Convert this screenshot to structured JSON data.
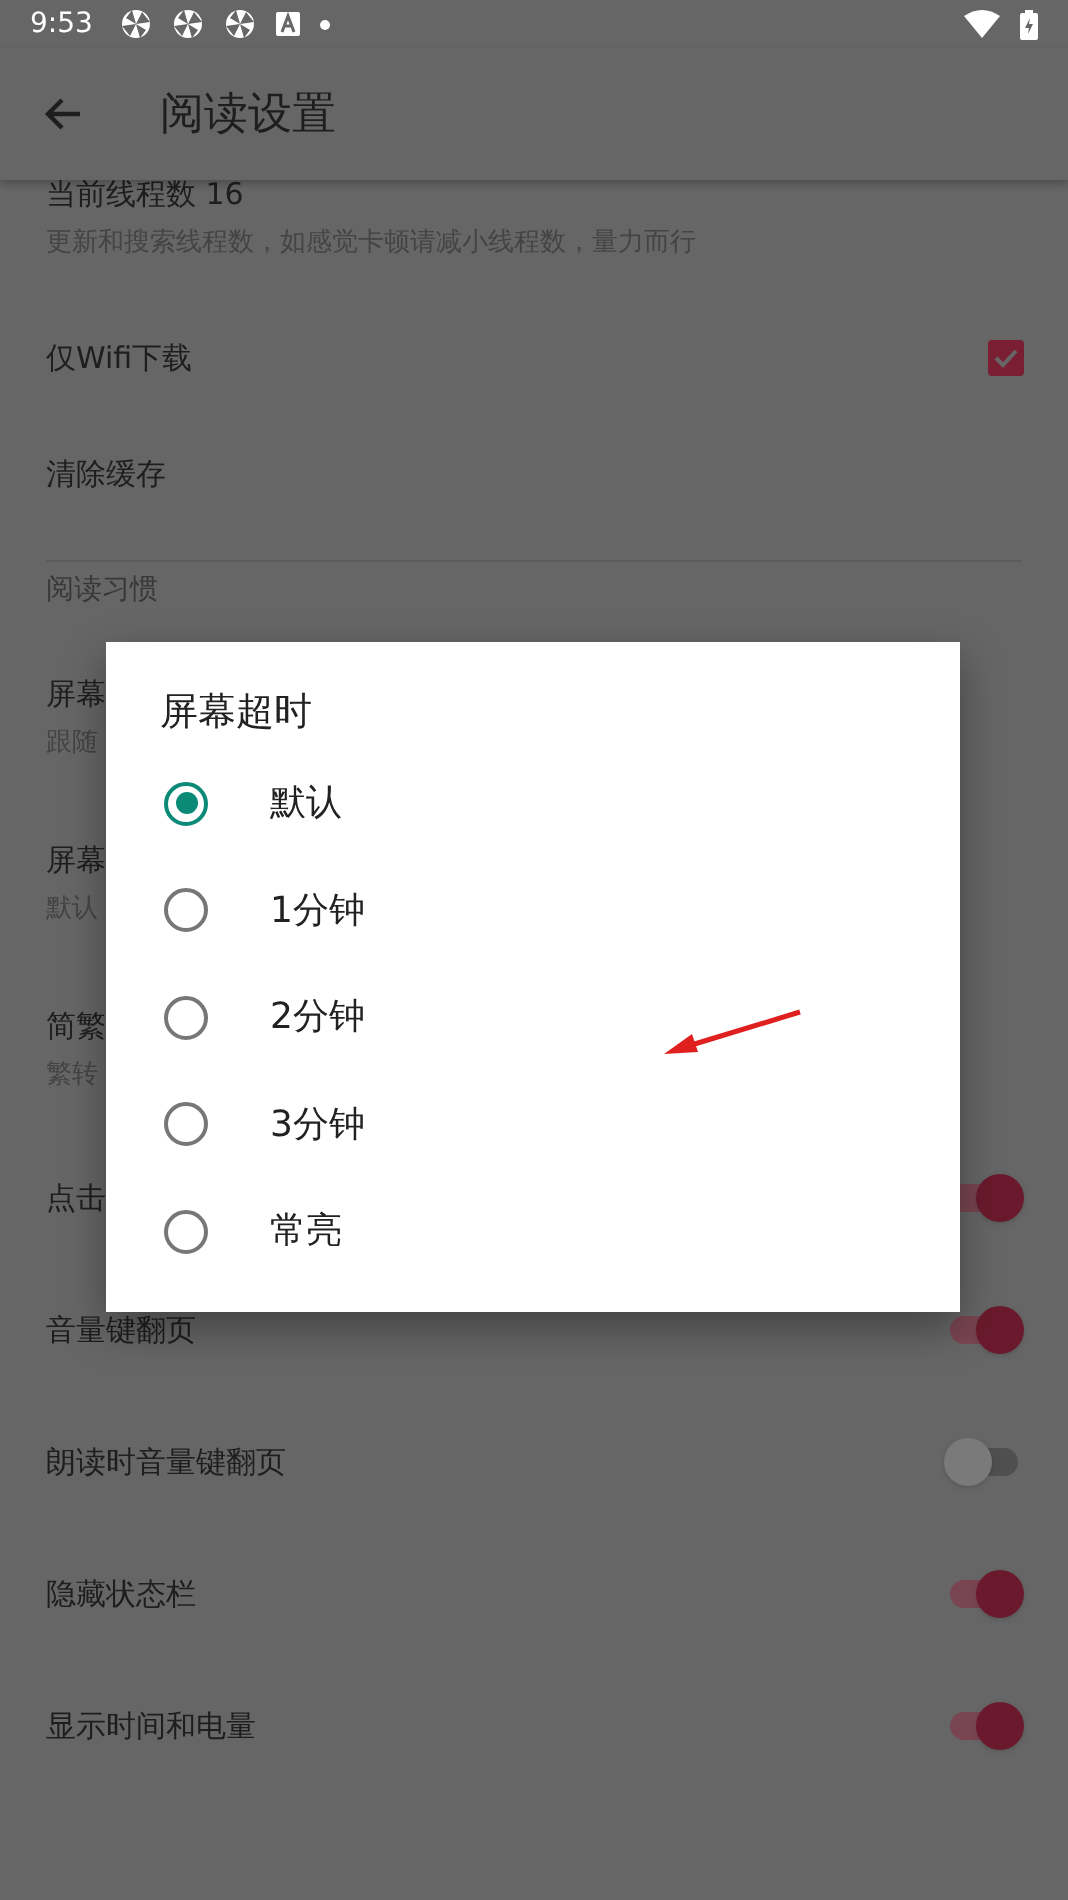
{
  "status_bar": {
    "time": "9:53"
  },
  "toolbar": {
    "title": "阅读设置"
  },
  "settings": [
    {
      "kind": "text",
      "title": "当前线程数 16",
      "summary": "更新和搜索线程数，如感觉卡顿请减小线程数，量力而行"
    },
    {
      "kind": "checkbox",
      "title": "仅Wifi下载",
      "checked": true
    },
    {
      "kind": "action",
      "title": "清除缓存"
    },
    {
      "kind": "divider"
    },
    {
      "kind": "category",
      "title": "阅读习惯"
    },
    {
      "kind": "text",
      "title": "屏幕",
      "summary": "跟随"
    },
    {
      "kind": "text",
      "title": "屏幕",
      "summary": "默认"
    },
    {
      "kind": "text",
      "title": "简繁",
      "summary": "繁转"
    },
    {
      "kind": "switch",
      "title": "点击",
      "on": true
    },
    {
      "kind": "switch",
      "title": "音量键翻页",
      "on": true
    },
    {
      "kind": "switch",
      "title": "朗读时音量键翻页",
      "on": false
    },
    {
      "kind": "switch",
      "title": "隐藏状态栏",
      "on": true
    },
    {
      "kind": "switch",
      "title": "显示时间和电量",
      "on": true
    }
  ],
  "dialog": {
    "title": "屏幕超时",
    "options": [
      {
        "label": "默认",
        "selected": true
      },
      {
        "label": "1分钟",
        "selected": false
      },
      {
        "label": "2分钟",
        "selected": false
      },
      {
        "label": "3分钟",
        "selected": false
      },
      {
        "label": "常亮",
        "selected": false
      }
    ]
  }
}
